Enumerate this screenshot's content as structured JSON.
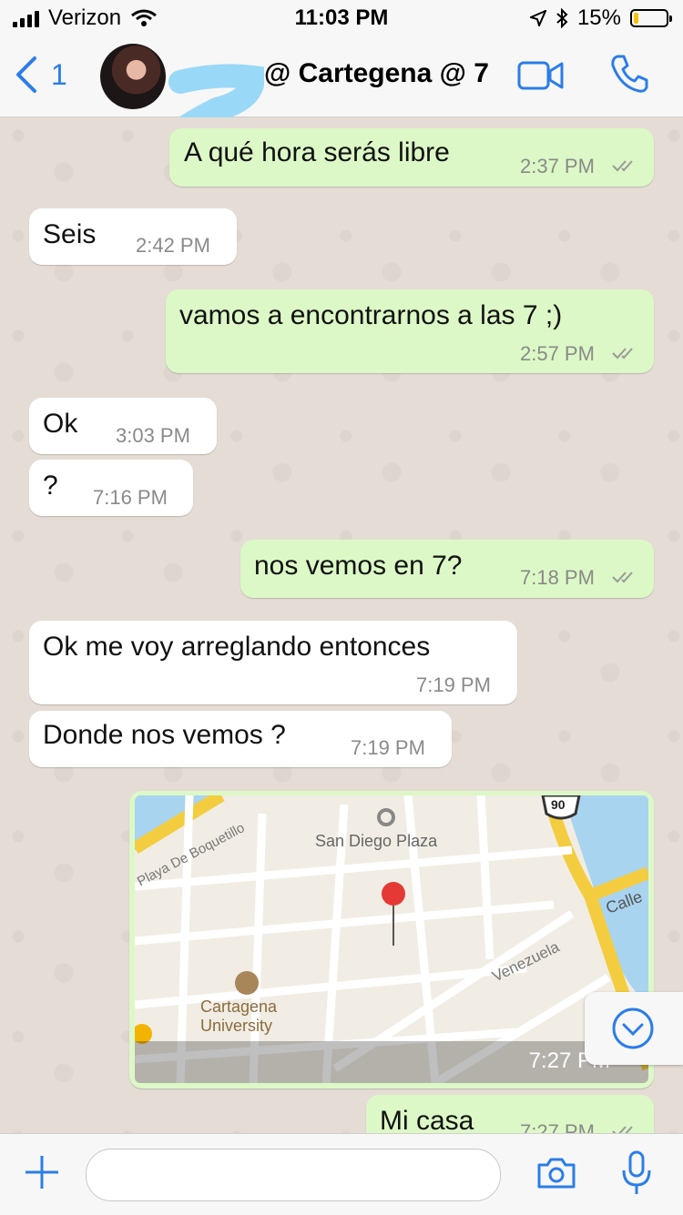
{
  "status_bar": {
    "carrier": "Verizon",
    "time": "11:03 PM",
    "battery_percent": "15%",
    "battery_level": 0.15
  },
  "header": {
    "back_count": "1",
    "title": "@ Cartegena @ 7"
  },
  "messages": [
    {
      "dir": "out",
      "text": "A qué hora serás libre",
      "time": "2:37 PM"
    },
    {
      "dir": "in",
      "text": "Seis",
      "time": "2:42 PM"
    },
    {
      "dir": "out",
      "text": "vamos a encontrarnos a las 7 ;)",
      "time": "2:57 PM"
    },
    {
      "dir": "in",
      "text": "Ok",
      "time": "3:03 PM"
    },
    {
      "dir": "in",
      "text": "?",
      "time": "7:16 PM"
    },
    {
      "dir": "out",
      "text": "nos vemos en 7?",
      "time": "7:18 PM"
    },
    {
      "dir": "in",
      "text": "Ok  me voy arreglando entonces",
      "time": "7:19 PM"
    },
    {
      "dir": "in",
      "text": "Donde nos vemos ?",
      "time": "7:19 PM"
    },
    {
      "dir": "out",
      "text": "Mi casa",
      "time": "7:27 PM"
    }
  ],
  "map_message": {
    "time": "7:27 PM",
    "labels": {
      "plaza": "San Diego Plaza",
      "street1": "Playa De Boquetillo",
      "street2": "Venezuela",
      "street3": "Calle",
      "university_line1": "Cartagena",
      "university_line2": "University",
      "route": "90"
    }
  },
  "colors": {
    "accent": "#2b7de9",
    "outgoing": "#dcf8c6",
    "incoming": "#ffffff",
    "background": "#e5ddd5"
  }
}
